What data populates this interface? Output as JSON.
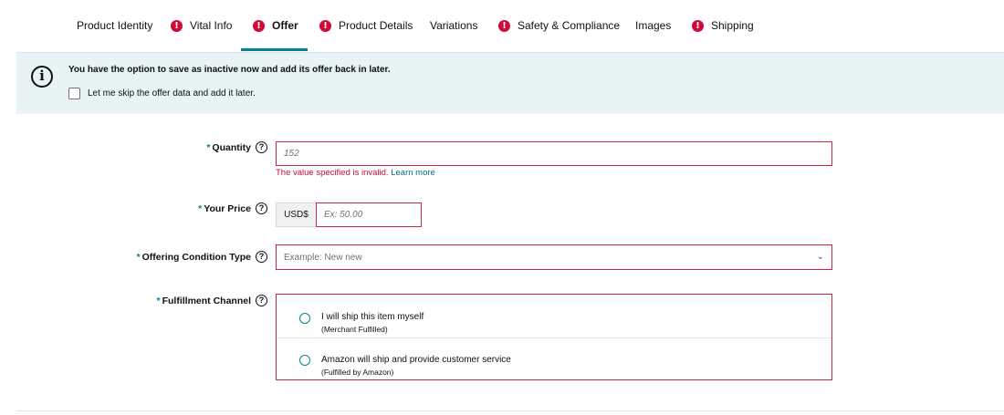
{
  "tabs": [
    {
      "label": "Product Identity",
      "alert": false,
      "active": false
    },
    {
      "label": "Vital Info",
      "alert": true,
      "active": false
    },
    {
      "label": "Offer",
      "alert": true,
      "active": true
    },
    {
      "label": "Product Details",
      "alert": true,
      "active": false
    },
    {
      "label": "Variations",
      "alert": false,
      "active": false
    },
    {
      "label": "Safety & Compliance",
      "alert": true,
      "active": false
    },
    {
      "label": "Images",
      "alert": false,
      "active": false
    },
    {
      "label": "Shipping",
      "alert": true,
      "active": false
    }
  ],
  "alert_glyph": "!",
  "banner": {
    "icon": "i",
    "title": "You have the option to save as inactive now and add its offer back in later.",
    "skip_label": "Let me skip the offer data and add it later."
  },
  "form": {
    "required_mark": "*",
    "help_glyph": "?",
    "quantity": {
      "label": "Quantity",
      "value": "152",
      "error": "The value specified is invalid.",
      "error_link": "Learn more"
    },
    "price": {
      "label": "Your Price",
      "currency": "USD$",
      "placeholder": "Ex: 50.00"
    },
    "condition": {
      "label": "Offering Condition Type",
      "placeholder": "Example: New new",
      "chevron": "⌄"
    },
    "fulfillment": {
      "label": "Fulfillment Channel",
      "options": [
        {
          "title": "I will ship this item myself",
          "sub": "(Merchant Fulfilled)"
        },
        {
          "title": "Amazon will ship and provide customer service",
          "sub": "(Fulfilled by Amazon)"
        }
      ]
    }
  },
  "colors": {
    "accent": "#008296",
    "error": "#cc0c39",
    "banner_bg": "#e7f3f5"
  }
}
